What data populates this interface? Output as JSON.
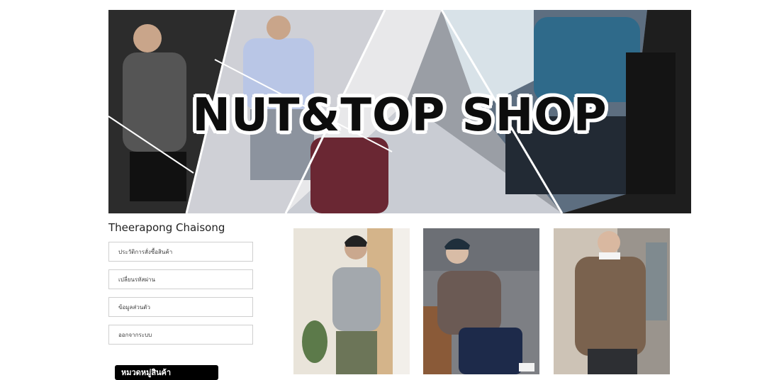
{
  "banner": {
    "title": "NUT&TOP SHOP"
  },
  "user": {
    "name": "Theerapong Chaisong"
  },
  "menu": {
    "items": [
      {
        "label": "ประวัติการสั่งซื้อสินค้า"
      },
      {
        "label": "เปลี่ยนรหัสผ่าน"
      },
      {
        "label": "ข้อมูลส่วนตัว"
      },
      {
        "label": "ออกจากระบบ"
      }
    ]
  },
  "categories": {
    "heading": "หมวดหมู่สินค้า"
  },
  "products": [
    {
      "image": "gray-hoodie-photo"
    },
    {
      "image": "knit-sweater-beanie-photo"
    },
    {
      "image": "brown-cable-knit-sweater-photo"
    }
  ]
}
